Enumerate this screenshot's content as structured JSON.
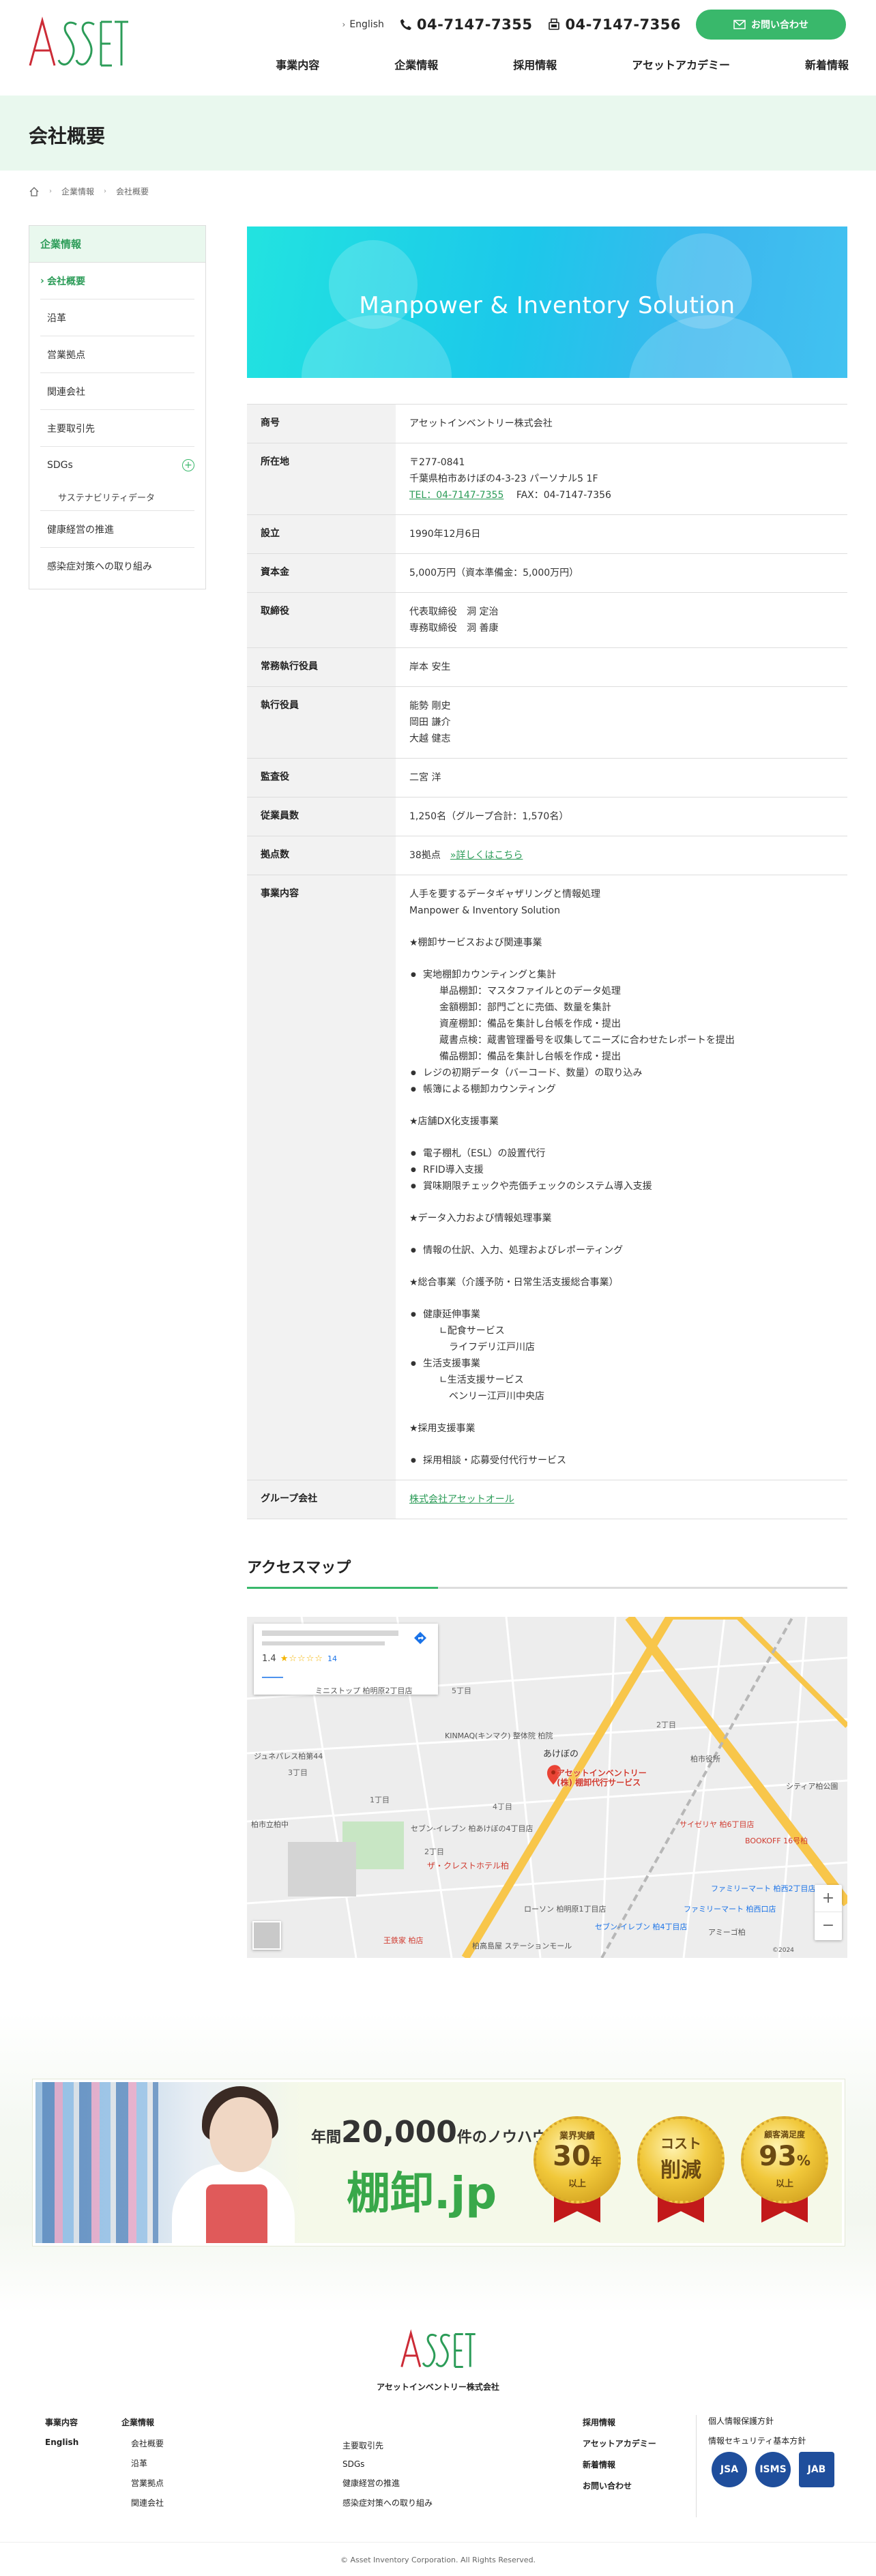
{
  "header": {
    "lang_label": "English",
    "tel": "04-7147-7355",
    "fax": "04-7147-7356",
    "contact_label": "お問い合わせ",
    "nav": [
      "事業内容",
      "企業情報",
      "採用情報",
      "アセットアカデミー",
      "新着情報"
    ]
  },
  "page": {
    "title": "会社概要",
    "breadcrumb": [
      "企業情報",
      "会社概要"
    ]
  },
  "sidebar": {
    "heading": "企業情報",
    "items": [
      "会社概要",
      "沿革",
      "営業拠点",
      "関連会社",
      "主要取引先",
      "SDGs"
    ],
    "sdgs_sub": "サステナビリティデータ",
    "items2": [
      "健康経営の推進",
      "感染症対策への取り組み"
    ]
  },
  "hero": {
    "title": "Manpower & Inventory Solution"
  },
  "company": {
    "name_label": "商号",
    "name": "アセットインベントリー株式会社",
    "address_label": "所在地",
    "zip": "〒277-0841",
    "address": "千葉県柏市あけぼの4-3-23 パーソナル5 1F",
    "tel_text": "TEL：04-7147-7355",
    "fax_text": "FAX：04-7147-7356",
    "founded_label": "設立",
    "founded": "1990年12月6日",
    "capital_label": "資本金",
    "capital": "5,000万円（資本準備金：5,000万円）",
    "directors_label": "取締役",
    "directors": [
      "代表取締役　洞 定治",
      "専務取締役　洞 善康"
    ],
    "managing_label": "常務執行役員",
    "managing": "岸本 安生",
    "officers_label": "執行役員",
    "officers": [
      "能勢 剛史",
      "岡田 謙介",
      "大越 健志"
    ],
    "auditor_label": "監査役",
    "auditor": "二宮 洋",
    "employees_label": "従業員数",
    "employees": "1,250名（グループ合計：1,570名）",
    "bases_label": "拠点数",
    "bases": "38拠点",
    "bases_link": "»詳しくはこちら",
    "business_label": "事業内容",
    "business_intro": [
      "人手を要するデータギャザリングと情報処理",
      "Manpower & Inventory Solution"
    ],
    "inv_head": "★棚卸サービスおよび関連事業",
    "inv_list_1": "実地棚卸カウンティングと集計",
    "inv_sub": [
      "単品棚卸：マスタファイルとのデータ処理",
      "金額棚卸：部門ごとに売価、数量を集計",
      "資産棚卸：備品を集計し台帳を作成・提出",
      "蔵書点検：蔵書管理番号を収集してニーズに合わせたレポートを提出",
      "備品棚卸：備品を集計し台帳を作成・提出"
    ],
    "inv_list_2": [
      "レジの初期データ（バーコード、数量）の取り込み",
      "帳簿による棚卸カウンティング"
    ],
    "dx_head": "★店舗DX化支援事業",
    "dx_list": [
      "電子棚札（ESL）の設置代行",
      "RFID導入支援",
      "賞味期限チェックや売価チェックのシステム導入支援"
    ],
    "data_head": "★データ入力および情報処理事業",
    "data_list": [
      "情報の仕訳、入力、処理およびレポーティング"
    ],
    "care_head": "★総合事業（介護予防・日常生活支援総合事業）",
    "care_1": "健康延伸事業",
    "care_1a": "∟配食サービス",
    "care_1b": "ライフデリ江戸川店",
    "care_2": "生活支援事業",
    "care_2a": "∟生活支援サービス",
    "care_2b": "ベンリー江戸川中央店",
    "rec_head": "★採用支援事業",
    "rec_list": [
      "採用相談・応募受付代行サービス"
    ],
    "group_label": "グループ会社",
    "group": "株式会社アセットオール"
  },
  "access": {
    "title": "アクセスマップ",
    "rating": "1.4",
    "stars": "★☆☆☆☆",
    "reviews": "14",
    "pin": [
      "アセットインベントリー",
      "(株) 棚卸代行サービス"
    ],
    "places": [
      "ミニストップ 柏明原2丁目店",
      "KINMAQ(キンマク) 整体院 柏院",
      "あけぼの",
      "ジュネパレス柏第44",
      "セブン-イレブン 柏あけぼの4丁目店",
      "ザ・クレストホテル柏",
      "ローソン 柏明原1丁目店",
      "ファミリーマート 柏西口店",
      "セブン-イレブン 柏4丁目店",
      "アミーゴ柏",
      "サイゼリヤ 柏6丁目店",
      "BOOKOFF 16号柏",
      "柏市立柏中",
      "王鉄家 柏店",
      "柏高島屋 ステーションモール",
      "柏市役所",
      "シティア柏公園",
      "ファミリーマート 柏西2丁目店"
    ],
    "labels": [
      "5丁目",
      "2丁目",
      "1丁目",
      "3丁目",
      "4丁目",
      "2丁目"
    ],
    "footer_text": "©2024"
  },
  "promo": {
    "sub_pre": "年間",
    "sub_num": "20,000",
    "sub_post": "件のノウハウ",
    "main": "棚卸.jp",
    "medals": [
      {
        "top": "業界実績",
        "mid": "30",
        "mid_suffix": "年",
        "bottom": "以上"
      },
      {
        "top": "コスト",
        "mid": "削減",
        "mid_suffix": "",
        "bottom": ""
      },
      {
        "top": "顧客満足度",
        "mid": "93",
        "mid_suffix": "%",
        "bottom": "以上"
      }
    ]
  },
  "footer": {
    "company": "アセットインベントリー株式会社",
    "col1": [
      "事業内容",
      "English"
    ],
    "col2_head": "企業情報",
    "col2": [
      "会社概要",
      "沿革",
      "営業拠点",
      "関連会社"
    ],
    "col3": [
      "主要取引先",
      "SDGs",
      "健康経営の推進",
      "感染症対策への取り組み"
    ],
    "col4": [
      "採用情報",
      "アセットアカデミー",
      "新着情報",
      "お問い合わせ"
    ],
    "col5": [
      "個人情報保護方針",
      "情報セキュリティ基本方針"
    ],
    "certs": [
      "JSA",
      "ISMS",
      "JAB"
    ],
    "copyright": "© Asset Inventory Corporation. All Rights Reserved."
  }
}
